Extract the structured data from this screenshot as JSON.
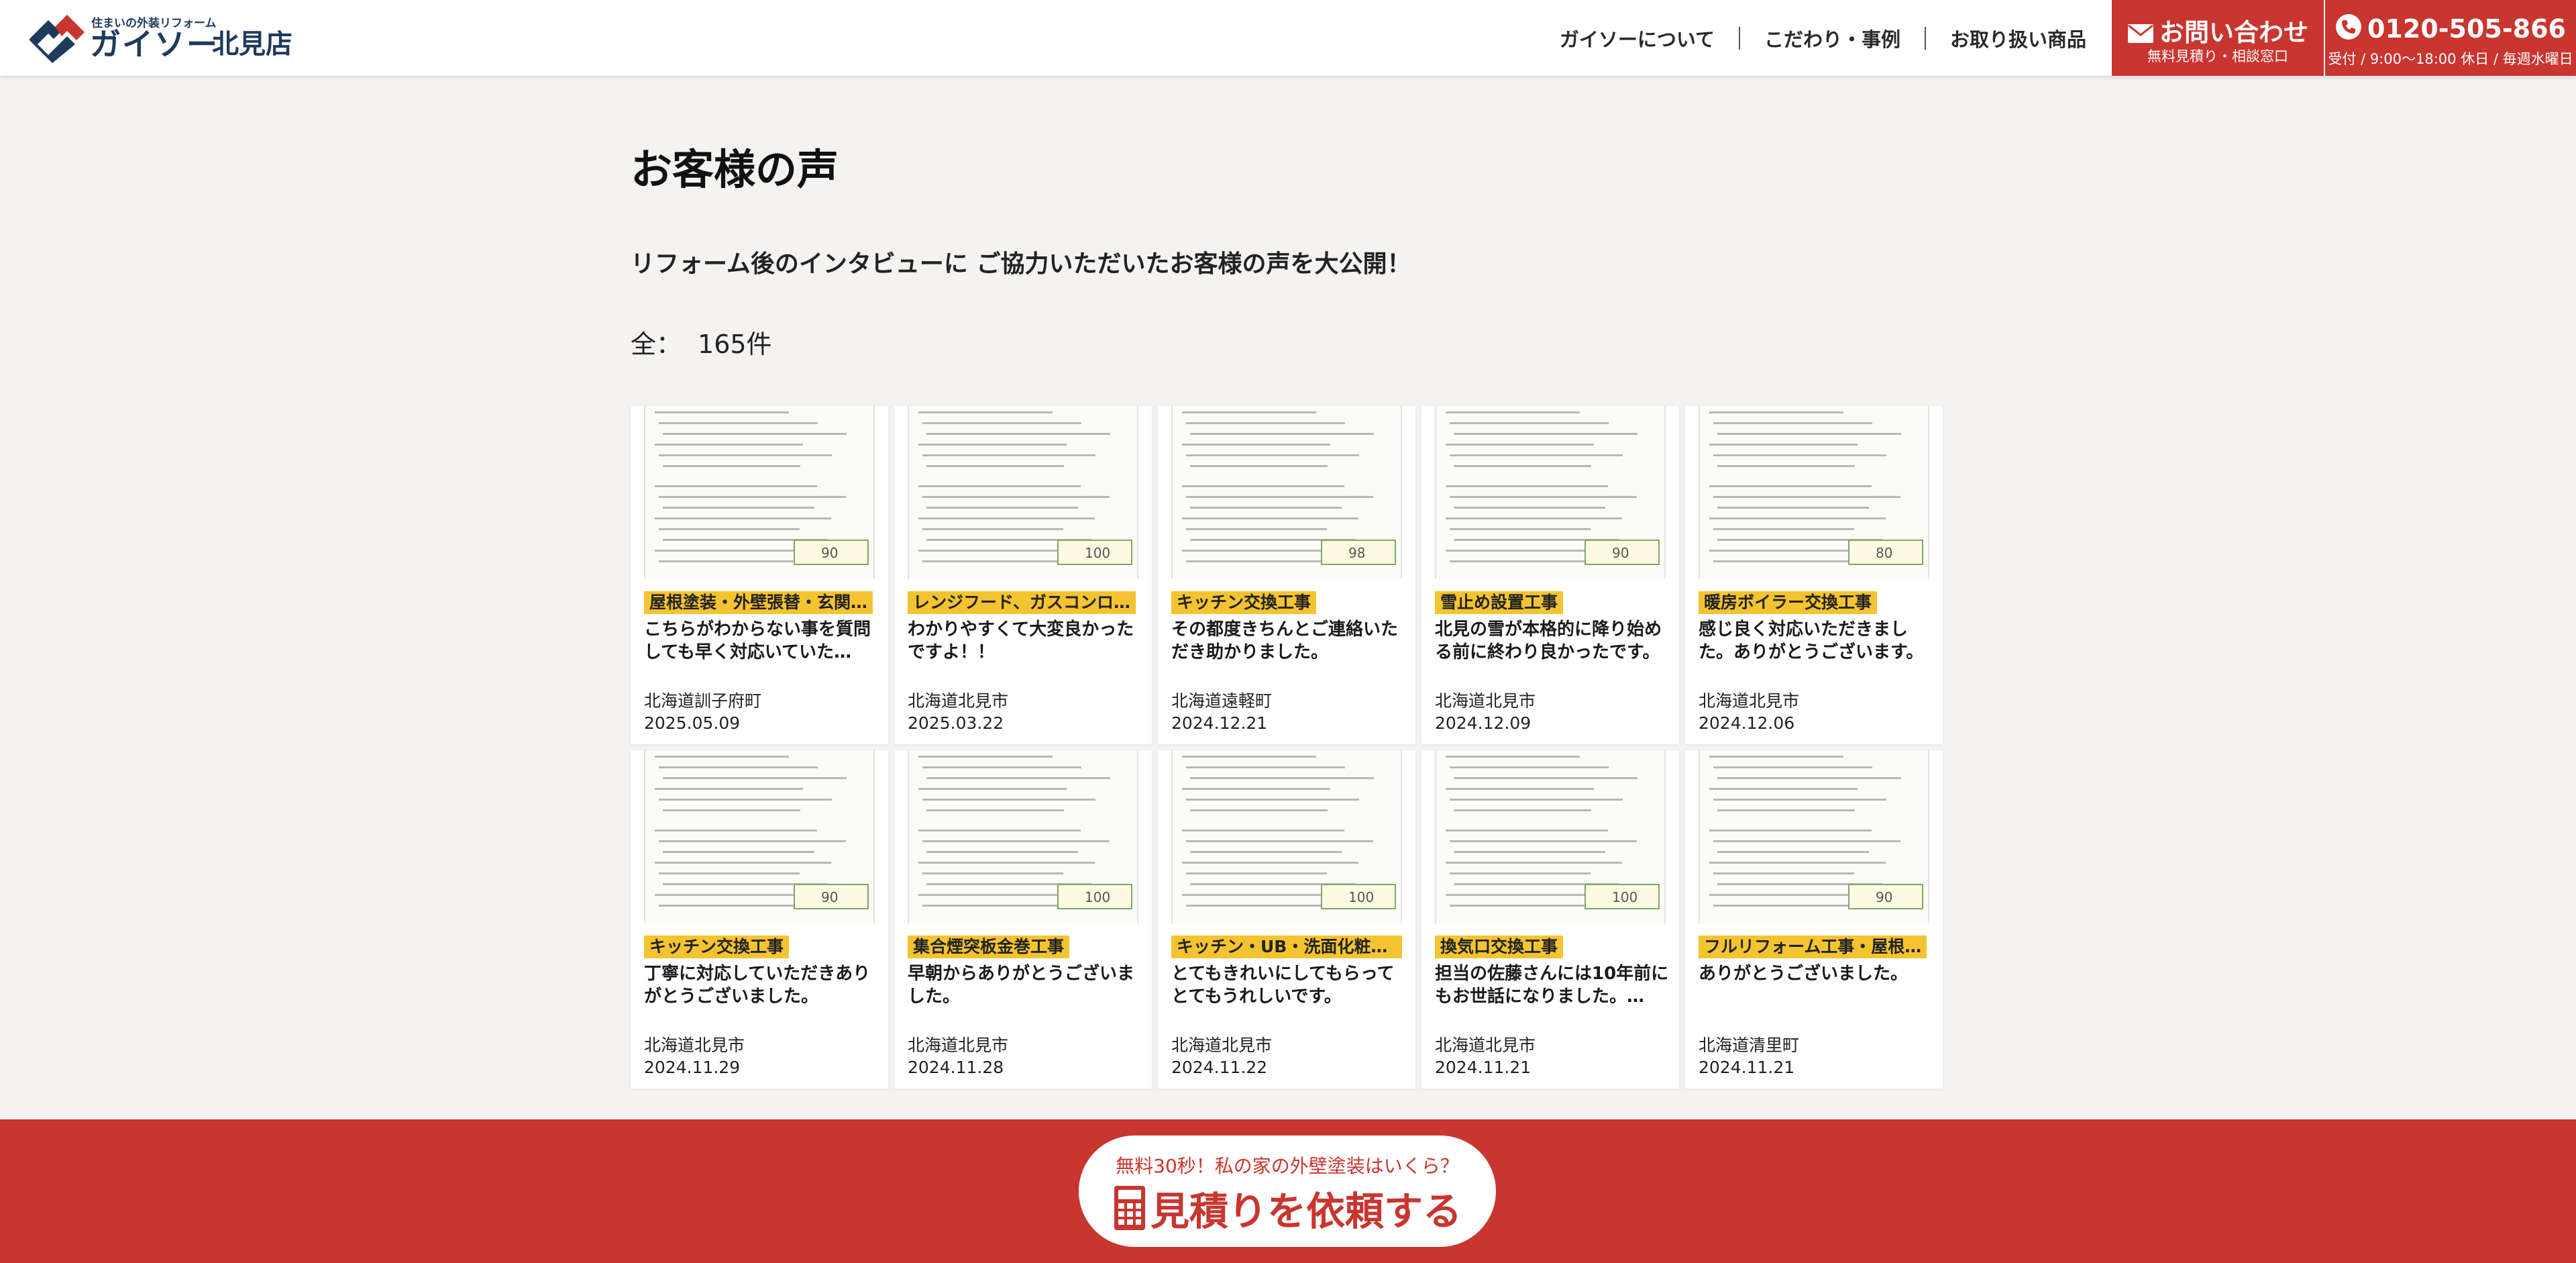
{
  "header": {
    "logo_tagline": "住まいの外装リフォーム",
    "brand": "ガイソー",
    "store": "北見店",
    "nav": [
      {
        "label": "ガイソーについて"
      },
      {
        "label": "こだわり・事例"
      },
      {
        "label": "お取り扱い商品"
      }
    ],
    "contact": {
      "label": "お問い合わせ",
      "sub": "無料見積り・相談窓口"
    },
    "phone": {
      "number": "0120-505-866",
      "sub": "受付 / 9:00〜18:00 休日 / 毎週水曜日"
    }
  },
  "main": {
    "title": "お客様の声",
    "lead": "リフォーム後のインタビューに ご協力いただいたお客様の声を大公開！",
    "count_label": "全：",
    "count_value": "165件"
  },
  "cards": [
    {
      "tag": "屋根塗装・外壁張替・玄関…",
      "text": "こちらがわからない事を質問しても早く対応いていた…",
      "place": "北海道訓子府町",
      "date": "2025.05.09",
      "score": "90"
    },
    {
      "tag": "レンジフード、ガスコンロ…",
      "text": "わかりやすくて大変良かったですよ！！",
      "place": "北海道北見市",
      "date": "2025.03.22",
      "score": "100"
    },
    {
      "tag": "キッチン交換工事",
      "text": "その都度きちんとご連絡いただき助かりました。",
      "place": "北海道遠軽町",
      "date": "2024.12.21",
      "score": "98"
    },
    {
      "tag": "雪止め設置工事",
      "text": "北見の雪が本格的に降り始める前に終わり良かったです。",
      "place": "北海道北見市",
      "date": "2024.12.09",
      "score": "90"
    },
    {
      "tag": "暖房ボイラー交換工事",
      "text": "感じ良く対応いただきました。ありがとうございます。",
      "place": "北海道北見市",
      "date": "2024.12.06",
      "score": "80"
    },
    {
      "tag": "キッチン交換工事",
      "text": "丁寧に対応していただきありがとうございました。",
      "place": "北海道北見市",
      "date": "2024.11.29",
      "score": "90"
    },
    {
      "tag": "集合煙突板金巻工事",
      "text": "早朝からありがとうございました。",
      "place": "北海道北見市",
      "date": "2024.11.28",
      "score": "100"
    },
    {
      "tag": "キッチン・UB・洗面化粧台…",
      "text": "とてもきれいにしてもらってとてもうれしいです。",
      "place": "北海道北見市",
      "date": "2024.11.22",
      "score": "100"
    },
    {
      "tag": "換気口交換工事",
      "text": "担当の佐藤さんには10年前にもお世話になりました。…",
      "place": "北海道北見市",
      "date": "2024.11.21",
      "score": "100"
    },
    {
      "tag": "フルリフォーム工事・屋根…",
      "text": "ありがとうございました。",
      "place": "北海道清里町",
      "date": "2024.11.21",
      "score": "90"
    }
  ],
  "cta": {
    "sub": "無料30秒！私の家の外壁塗装はいくら？",
    "label": "見積りを依頼する"
  },
  "colors": {
    "brand_red": "#c9352f",
    "tag_yellow": "#f4c430",
    "brand_navy": "#1f3a5c",
    "background": "#f4f3f1"
  },
  "icons": {
    "contact": "mail-icon",
    "phone": "phone-icon",
    "cta": "calculator-icon"
  }
}
